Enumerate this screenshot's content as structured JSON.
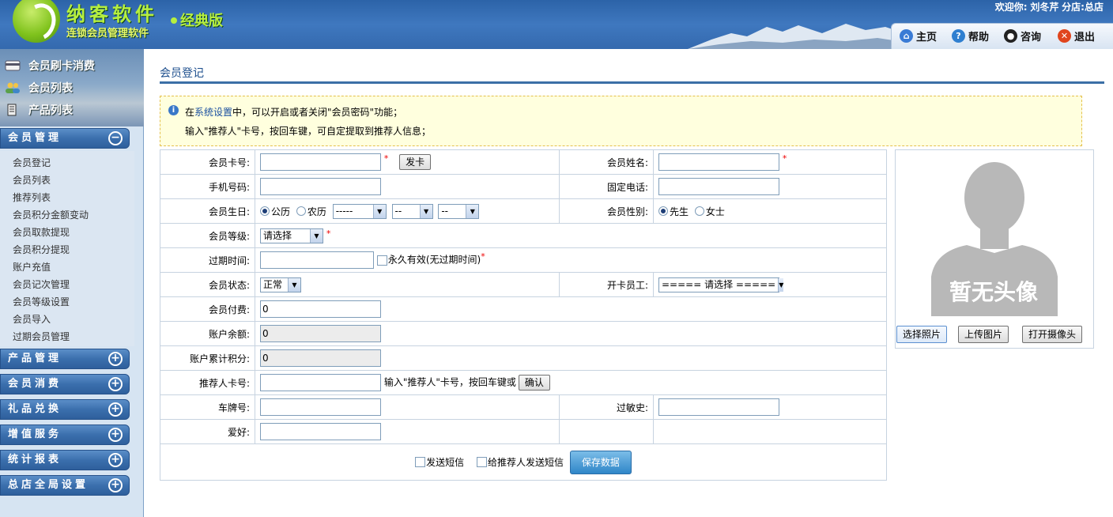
{
  "header": {
    "brand_title": "纳客软件",
    "brand_edition": "经典版",
    "brand_sub": "连锁会员管理软件",
    "welcome_prefix": "欢迎你:",
    "welcome_user": "刘冬芹",
    "welcome_store_prefix": "分店:",
    "welcome_store": "总店",
    "nav": [
      {
        "label": "主页",
        "icon": "home-icon",
        "color": "#3a7bd5"
      },
      {
        "label": "帮助",
        "icon": "help-icon",
        "color": "#2f7fd0"
      },
      {
        "label": "咨询",
        "icon": "qq-icon",
        "color": "#222222"
      },
      {
        "label": "退出",
        "icon": "logout-icon",
        "color": "#e0451d"
      }
    ]
  },
  "sidebar": {
    "quick": [
      "会员刷卡消费",
      "会员列表",
      "产品列表"
    ],
    "sections": [
      "会员管理",
      "产品管理",
      "会员消费",
      "礼品兑换",
      "增值服务",
      "统计报表",
      "总店全局设置"
    ],
    "sub_items": [
      "会员登记",
      "会员列表",
      "推荐列表",
      "会员积分金额变动",
      "会员取款提现",
      "会员积分提现",
      "账户充值",
      "会员记次管理",
      "会员等级设置",
      "会员导入",
      "过期会员管理"
    ]
  },
  "main": {
    "title": "会员登记",
    "notice": {
      "line1_pre": "在",
      "line1_link": "系统设置",
      "line1_post": "中，可以开启或者关闭\"会员密码\"功能；",
      "line2": "输入\"推荐人\"卡号，按回车键，可自定提取到推荐人信息；"
    },
    "form": {
      "card_no_label": "会员卡号:",
      "issue_card_button": "发卡",
      "name_label": "会员姓名:",
      "mobile_label": "手机号码:",
      "phone_label": "固定电话:",
      "birthday_label": "会员生日:",
      "calendar_solar": "公历",
      "calendar_lunar": "农历",
      "birth_year": "-----",
      "birth_month": "--",
      "birth_day": "--",
      "gender_label": "会员性别:",
      "gender_male": "先生",
      "gender_female": "女士",
      "level_label": "会员等级:",
      "level_value": "请选择",
      "expire_label": "过期时间:",
      "permanent_label": "永久有效(无过期时间)",
      "status_label": "会员状态:",
      "status_value": "正常",
      "staff_label": "开卡员工:",
      "staff_value": "===== 请选择 =====",
      "fee_label": "会员付费:",
      "fee_value": "0",
      "balance_label": "账户余额:",
      "balance_value": "0",
      "points_label": "账户累计积分:",
      "points_value": "0",
      "referrer_label": "推荐人卡号:",
      "referrer_hint": "输入\"推荐人\"卡号，按回车键或",
      "confirm_button": "确认",
      "plate_label": "车牌号:",
      "allergy_label": "过敏史:",
      "hobby_label": "爱好:",
      "send_sms": "发送短信",
      "send_sms_referrer": "给推荐人发送短信",
      "save_button": "保存数据"
    },
    "photo": {
      "placeholder": "暂无头像",
      "select_button": "选择照片",
      "upload_button": "上传图片",
      "camera_button": "打开摄像头"
    }
  }
}
